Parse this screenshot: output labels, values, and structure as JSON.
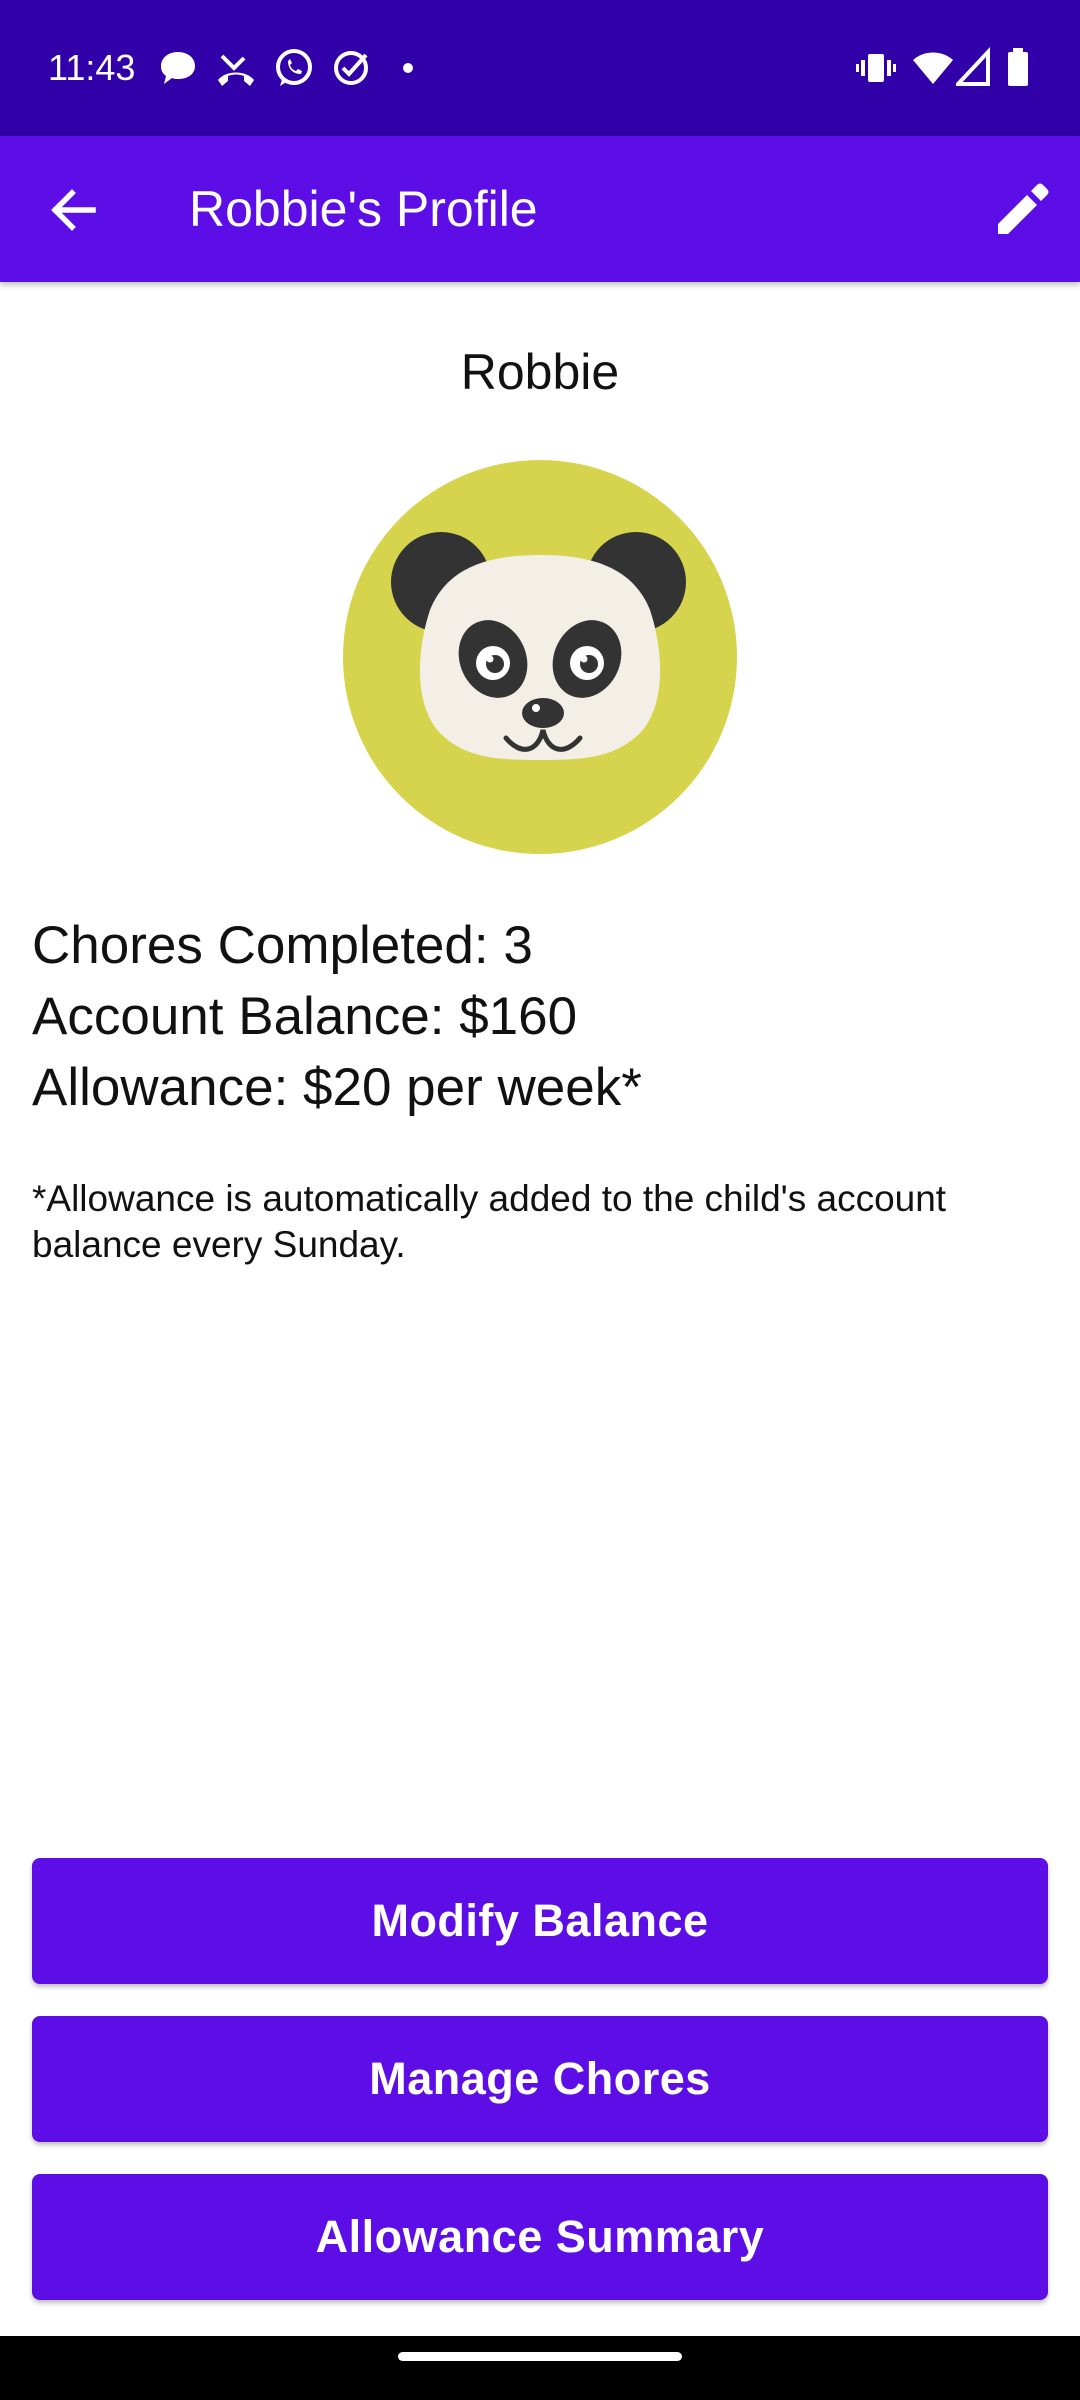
{
  "status_bar": {
    "time": "11:43",
    "left_icons": [
      "message-icon",
      "missed-call-icon",
      "whatsapp-icon",
      "check-circle-icon",
      "dot-icon"
    ],
    "right_icons": [
      "vibrate-icon",
      "wifi-icon",
      "signal-icon",
      "battery-icon"
    ]
  },
  "app_bar": {
    "title": "Robbie's Profile",
    "back_icon": "arrow-back-icon",
    "edit_icon": "pencil-icon"
  },
  "profile": {
    "name": "Robbie",
    "avatar": "panda-avatar",
    "avatar_bg": "#d6d44c",
    "stats": {
      "chores": "Chores Completed: 3",
      "balance": "Account Balance: $160",
      "allowance": "Allowance: $20 per week*"
    },
    "note": "*Allowance is automatically added to the child's account balance every Sunday."
  },
  "actions": {
    "modify_balance": "Modify Balance",
    "manage_chores": "Manage Chores",
    "allowance_summary": "Allowance Summary"
  },
  "colors": {
    "status_bar": "#3100a8",
    "primary": "#5d0ee6"
  }
}
